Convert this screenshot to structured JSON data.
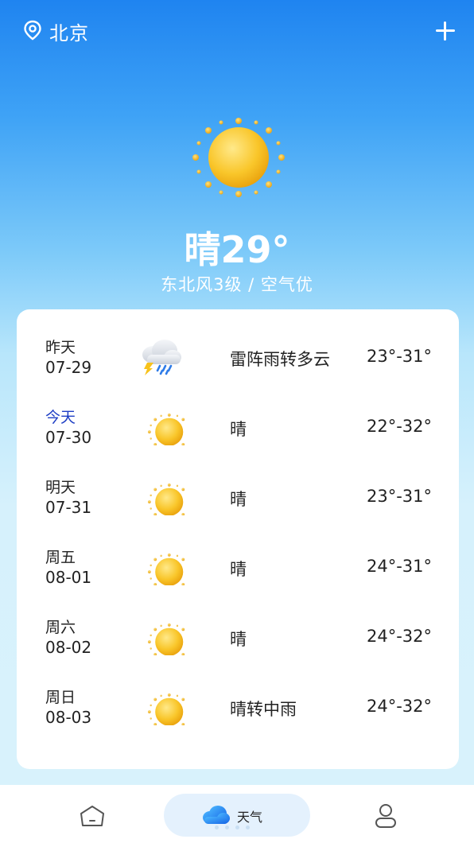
{
  "header": {
    "location_icon": "location-pin-icon",
    "city": "北京",
    "add_icon": "plus-icon"
  },
  "current": {
    "icon": "sun-icon",
    "temp_text": "晴29°",
    "wind_air": "东北风3级 / 空气优"
  },
  "forecast": [
    {
      "day": "昨天",
      "date": "07-29",
      "icon": "thunder-rain-icon",
      "condition": "雷阵雨转多云",
      "range": "23°-31°"
    },
    {
      "day": "今天",
      "date": "07-30",
      "icon": "sun-icon",
      "condition": "晴",
      "range": "22°-32°"
    },
    {
      "day": "明天",
      "date": "07-31",
      "icon": "sun-icon",
      "condition": "晴",
      "range": "23°-31°"
    },
    {
      "day": "周五",
      "date": "08-01",
      "icon": "sun-icon",
      "condition": "晴",
      "range": "24°-31°"
    },
    {
      "day": "周六",
      "date": "08-02",
      "icon": "sun-icon",
      "condition": "晴",
      "range": "24°-32°"
    },
    {
      "day": "周日",
      "date": "08-03",
      "icon": "sun-icon",
      "condition": "晴转中雨",
      "range": "24°-32°"
    }
  ],
  "tabbar": {
    "home_icon": "home-icon",
    "weather_icon": "cloud-icon",
    "weather_label": "天气",
    "profile_icon": "user-icon"
  },
  "colors": {
    "today_accent": "#1e3ec4",
    "active_tab_bg": "#e4f1fd"
  }
}
